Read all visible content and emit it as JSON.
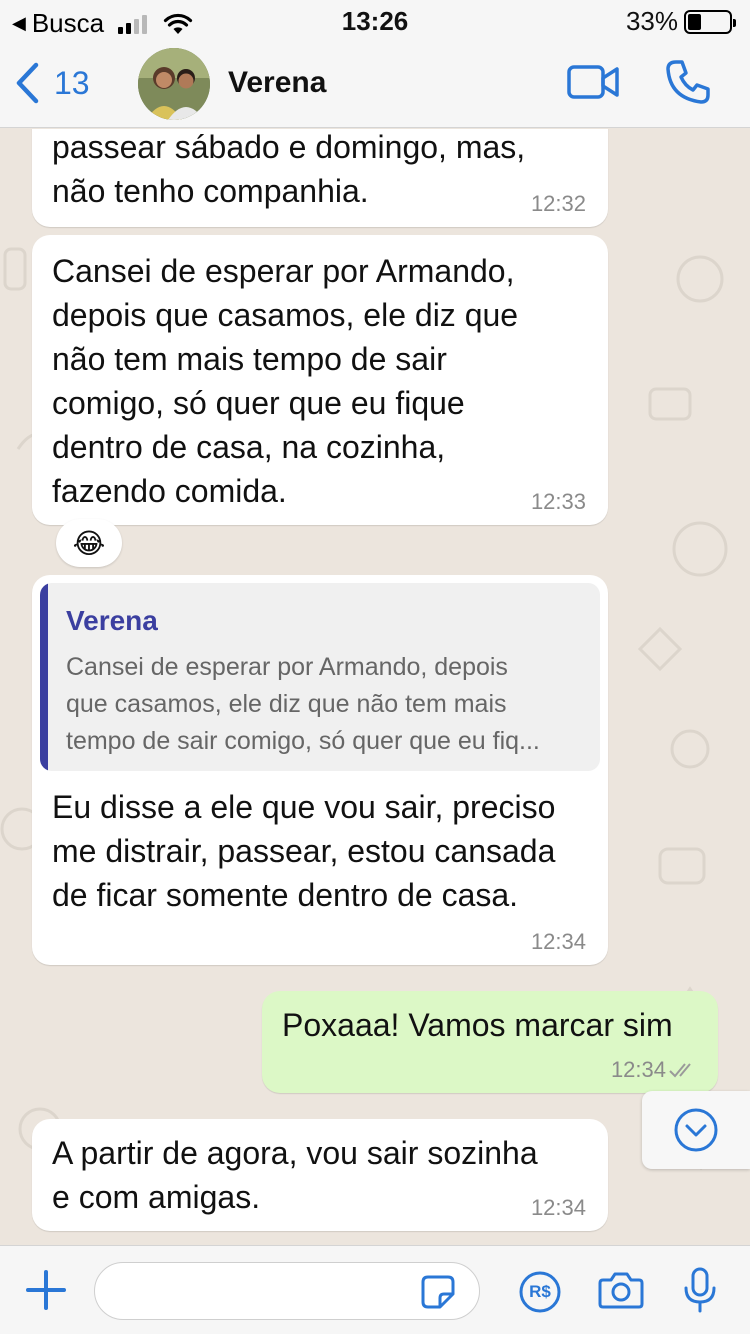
{
  "status_bar": {
    "back_app": "Busca",
    "time": "13:26",
    "battery_percent": "33%",
    "battery_level": 0.33,
    "signal_bars": 2
  },
  "header": {
    "back_count": "13",
    "contact_name": "Verena",
    "icons": [
      "chevron-left-icon",
      "video-call-icon",
      "phone-icon"
    ]
  },
  "messages": [
    {
      "direction": "incoming",
      "lines": [
        "passear sábado e domingo, mas,",
        "não tenho companhia."
      ],
      "time": "12:32"
    },
    {
      "direction": "incoming",
      "lines": [
        "Cansei de esperar por Armando,",
        "depois que casamos, ele diz que",
        "não tem mais tempo de sair",
        "comigo, só quer que eu fique",
        "dentro de casa, na cozinha,",
        "fazendo comida."
      ],
      "time": "12:33",
      "reaction": "😂"
    },
    {
      "direction": "incoming",
      "quoted": {
        "author": "Verena",
        "lines": [
          "Cansei de esperar por Armando, depois",
          "que casamos, ele diz que não tem mais",
          "tempo de sair comigo, só quer que eu fiq..."
        ]
      },
      "lines": [
        "Eu disse a ele que vou sair, preciso",
        "me distrair, passear, estou cansada",
        "de ficar somente dentro de casa."
      ],
      "time": "12:34"
    },
    {
      "direction": "outgoing",
      "lines": [
        "Poxaaa! Vamos marcar sim"
      ],
      "time": "12:34",
      "status": "read"
    },
    {
      "direction": "incoming",
      "lines": [
        "A partir de agora, vou sair sozinha",
        "e com amigas."
      ],
      "time": "12:34"
    }
  ],
  "input_bar": {
    "placeholder": "",
    "icons": [
      "plus-icon",
      "sticker-icon",
      "payment-icon",
      "camera-icon",
      "microphone-icon"
    ],
    "payment_label": "R$"
  },
  "colors": {
    "accent": "#2a77d6",
    "outgoing_bubble": "#dcf8c6",
    "incoming_bubble": "#ffffff",
    "chat_background": "#ece5dd",
    "quote_author": "#3b3fa0"
  }
}
